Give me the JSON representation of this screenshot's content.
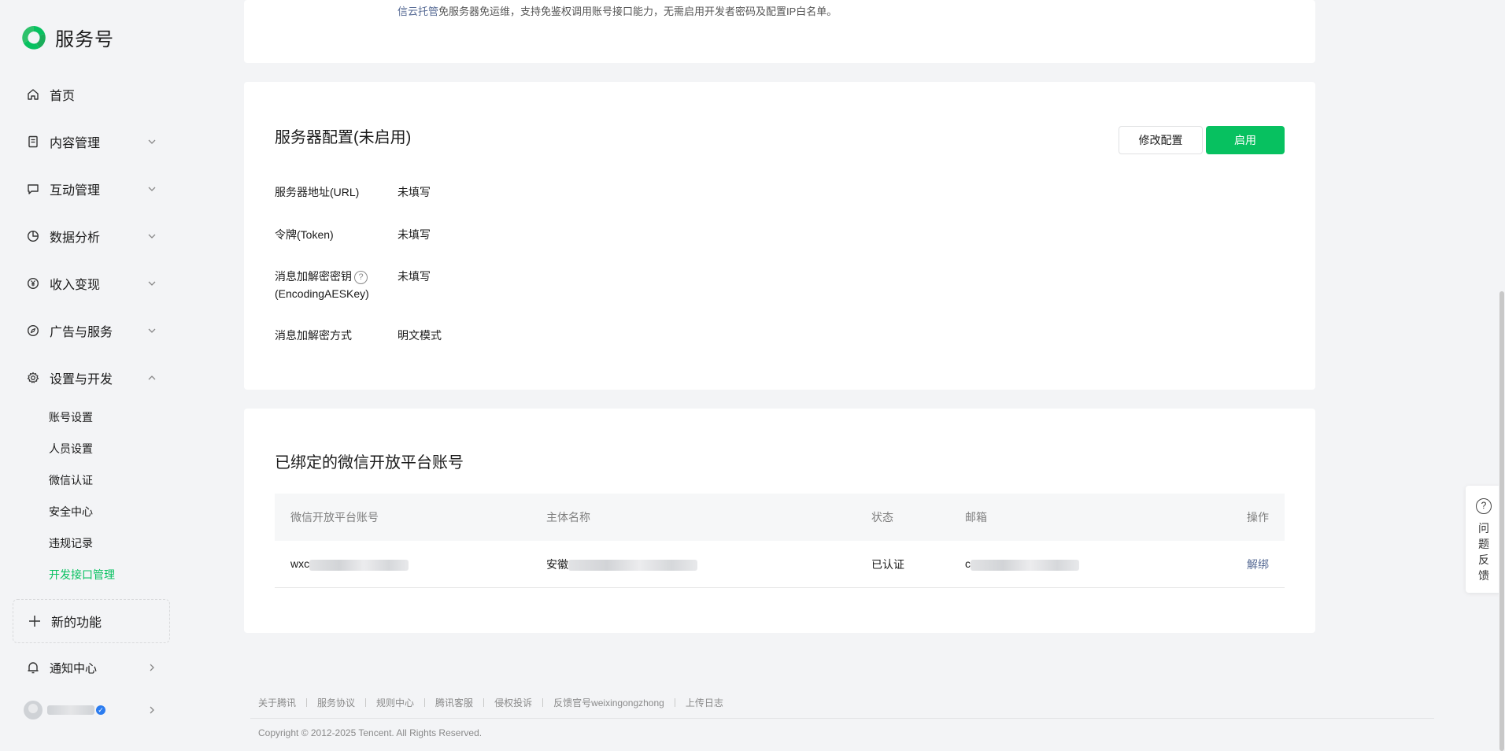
{
  "brand": {
    "name": "服务号",
    "logo_icon": "wechat-service-logo-icon",
    "accent": "#07c160"
  },
  "sidebar": {
    "items": [
      {
        "label": "首页",
        "icon": "home-icon"
      },
      {
        "label": "内容管理",
        "icon": "document-icon"
      },
      {
        "label": "互动管理",
        "icon": "chat-icon"
      },
      {
        "label": "数据分析",
        "icon": "pie-chart-icon"
      },
      {
        "label": "收入变现",
        "icon": "yen-icon"
      },
      {
        "label": "广告与服务",
        "icon": "compass-icon"
      },
      {
        "label": "设置与开发",
        "icon": "gear-icon"
      }
    ],
    "subitems": [
      {
        "label": "账号设置"
      },
      {
        "label": "人员设置"
      },
      {
        "label": "微信认证"
      },
      {
        "label": "安全中心"
      },
      {
        "label": "违规记录"
      },
      {
        "label": "开发接口管理",
        "active": true
      }
    ],
    "new_features": "新的功能",
    "notify": "通知中心"
  },
  "top_note": {
    "link": "信云托管",
    "text": "免服务器免运维，支持免鉴权调用账号接口能力，无需启用开发者密码及配置IP白名单。"
  },
  "server_config": {
    "title": "服务器配置(未启用)",
    "modify_button": "修改配置",
    "enable_button": "启用",
    "fields": [
      {
        "label": "服务器地址(URL)",
        "value": "未填写"
      },
      {
        "label": "令牌(Token)",
        "value": "未填写"
      },
      {
        "label": "消息加解密密钥",
        "label2": "(EncodingAESKey)",
        "value": "未填写"
      },
      {
        "label": "消息加解密方式",
        "value": "明文模式"
      }
    ]
  },
  "bound_accounts": {
    "title": "已绑定的微信开放平台账号",
    "headers": [
      "微信开放平台账号",
      "主体名称",
      "状态",
      "邮箱",
      "操作"
    ],
    "row": {
      "account_prefix": "wxc",
      "entity_prefix": "安徽",
      "status": "已认证",
      "email_prefix": "c",
      "action": "解绑"
    }
  },
  "footer": {
    "links": [
      "关于腾讯",
      "服务协议",
      "规则中心",
      "腾讯客服",
      "侵权投诉",
      "反馈官号weixingongzhong",
      "上传日志"
    ],
    "copyright": "Copyright © 2012-2025 Tencent. All Rights Reserved."
  },
  "feedback": {
    "label": "问题反馈",
    "icon": "question-icon"
  }
}
